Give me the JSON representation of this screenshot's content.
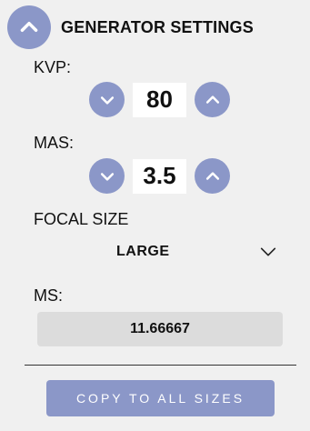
{
  "header": {
    "title": "GENERATOR SETTINGS",
    "collapse_icon": "chevron-up-icon"
  },
  "kvp": {
    "label": "KVP:",
    "value": "80",
    "decrement_icon": "chevron-down-icon",
    "increment_icon": "chevron-up-icon"
  },
  "mas": {
    "label": "MAS:",
    "value": "3.5",
    "decrement_icon": "chevron-down-icon",
    "increment_icon": "chevron-up-icon"
  },
  "focal_size": {
    "label": "FOCAL SIZE",
    "selected": "LARGE",
    "dropdown_icon": "chevron-down-icon"
  },
  "ms": {
    "label": "MS:",
    "value": "11.66667"
  },
  "actions": {
    "copy_label": "COPY TO ALL SIZES"
  },
  "colors": {
    "accent": "#8b97c8",
    "background": "#f0f0f0",
    "readonly_box": "#dcdcdc",
    "text": "#111111"
  }
}
